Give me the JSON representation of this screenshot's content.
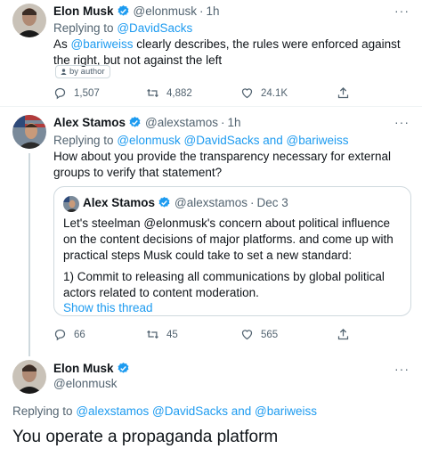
{
  "tweet1": {
    "name": "Elon Musk",
    "handle": "@elonmusk",
    "time": "1h",
    "replying_prefix": "Replying to",
    "replying_to": "@DavidSacks",
    "text_before": "As ",
    "mention": "@bariweiss",
    "text_after": " clearly describes, the rules were enforced against the right, but not against the left",
    "badge": "by author",
    "replies": "1,507",
    "retweets": "4,882",
    "likes": "24.1K"
  },
  "tweet2": {
    "name": "Alex Stamos",
    "handle": "@alexstamos",
    "time": "1h",
    "replying_prefix": "Replying to",
    "replying_to": "@elonmusk @DavidSacks and @bariweiss",
    "text": "How about you provide the transparency necessary for external groups to verify that statement?",
    "quote": {
      "name": "Alex Stamos",
      "handle": "@alexstamos",
      "time": "Dec 3",
      "para1": "Let's steelman @elonmusk's concern about political influence on the content decisions of major platforms. and come up with practical steps Musk could take to set a new standard:",
      "para2": "1) Commit to releasing all communications by global political actors related to content moderation.",
      "show_thread": "Show this thread"
    },
    "replies": "66",
    "retweets": "45",
    "likes": "565"
  },
  "tweet3": {
    "name": "Elon Musk",
    "handle": "@elonmusk",
    "replying_prefix": "Replying to",
    "replying_to": "@alexstamos @DavidSacks and @bariweiss",
    "text": "You operate a propaganda platform"
  },
  "more_label": "···",
  "colors": {
    "accent": "#1d9bf0",
    "muted": "#536471",
    "border": "#cfd9de"
  }
}
